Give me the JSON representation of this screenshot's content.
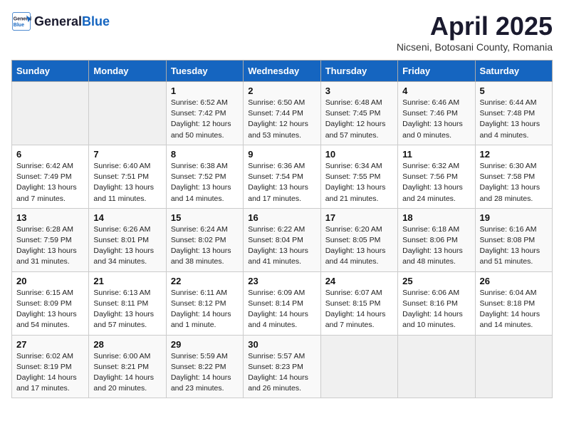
{
  "logo": {
    "general": "General",
    "blue": "Blue"
  },
  "title": "April 2025",
  "subtitle": "Nicseni, Botosani County, Romania",
  "days_of_week": [
    "Sunday",
    "Monday",
    "Tuesday",
    "Wednesday",
    "Thursday",
    "Friday",
    "Saturday"
  ],
  "weeks": [
    [
      {
        "day": "",
        "info": ""
      },
      {
        "day": "",
        "info": ""
      },
      {
        "day": "1",
        "info": "Sunrise: 6:52 AM\nSunset: 7:42 PM\nDaylight: 12 hours and 50 minutes."
      },
      {
        "day": "2",
        "info": "Sunrise: 6:50 AM\nSunset: 7:44 PM\nDaylight: 12 hours and 53 minutes."
      },
      {
        "day": "3",
        "info": "Sunrise: 6:48 AM\nSunset: 7:45 PM\nDaylight: 12 hours and 57 minutes."
      },
      {
        "day": "4",
        "info": "Sunrise: 6:46 AM\nSunset: 7:46 PM\nDaylight: 13 hours and 0 minutes."
      },
      {
        "day": "5",
        "info": "Sunrise: 6:44 AM\nSunset: 7:48 PM\nDaylight: 13 hours and 4 minutes."
      }
    ],
    [
      {
        "day": "6",
        "info": "Sunrise: 6:42 AM\nSunset: 7:49 PM\nDaylight: 13 hours and 7 minutes."
      },
      {
        "day": "7",
        "info": "Sunrise: 6:40 AM\nSunset: 7:51 PM\nDaylight: 13 hours and 11 minutes."
      },
      {
        "day": "8",
        "info": "Sunrise: 6:38 AM\nSunset: 7:52 PM\nDaylight: 13 hours and 14 minutes."
      },
      {
        "day": "9",
        "info": "Sunrise: 6:36 AM\nSunset: 7:54 PM\nDaylight: 13 hours and 17 minutes."
      },
      {
        "day": "10",
        "info": "Sunrise: 6:34 AM\nSunset: 7:55 PM\nDaylight: 13 hours and 21 minutes."
      },
      {
        "day": "11",
        "info": "Sunrise: 6:32 AM\nSunset: 7:56 PM\nDaylight: 13 hours and 24 minutes."
      },
      {
        "day": "12",
        "info": "Sunrise: 6:30 AM\nSunset: 7:58 PM\nDaylight: 13 hours and 28 minutes."
      }
    ],
    [
      {
        "day": "13",
        "info": "Sunrise: 6:28 AM\nSunset: 7:59 PM\nDaylight: 13 hours and 31 minutes."
      },
      {
        "day": "14",
        "info": "Sunrise: 6:26 AM\nSunset: 8:01 PM\nDaylight: 13 hours and 34 minutes."
      },
      {
        "day": "15",
        "info": "Sunrise: 6:24 AM\nSunset: 8:02 PM\nDaylight: 13 hours and 38 minutes."
      },
      {
        "day": "16",
        "info": "Sunrise: 6:22 AM\nSunset: 8:04 PM\nDaylight: 13 hours and 41 minutes."
      },
      {
        "day": "17",
        "info": "Sunrise: 6:20 AM\nSunset: 8:05 PM\nDaylight: 13 hours and 44 minutes."
      },
      {
        "day": "18",
        "info": "Sunrise: 6:18 AM\nSunset: 8:06 PM\nDaylight: 13 hours and 48 minutes."
      },
      {
        "day": "19",
        "info": "Sunrise: 6:16 AM\nSunset: 8:08 PM\nDaylight: 13 hours and 51 minutes."
      }
    ],
    [
      {
        "day": "20",
        "info": "Sunrise: 6:15 AM\nSunset: 8:09 PM\nDaylight: 13 hours and 54 minutes."
      },
      {
        "day": "21",
        "info": "Sunrise: 6:13 AM\nSunset: 8:11 PM\nDaylight: 13 hours and 57 minutes."
      },
      {
        "day": "22",
        "info": "Sunrise: 6:11 AM\nSunset: 8:12 PM\nDaylight: 14 hours and 1 minute."
      },
      {
        "day": "23",
        "info": "Sunrise: 6:09 AM\nSunset: 8:14 PM\nDaylight: 14 hours and 4 minutes."
      },
      {
        "day": "24",
        "info": "Sunrise: 6:07 AM\nSunset: 8:15 PM\nDaylight: 14 hours and 7 minutes."
      },
      {
        "day": "25",
        "info": "Sunrise: 6:06 AM\nSunset: 8:16 PM\nDaylight: 14 hours and 10 minutes."
      },
      {
        "day": "26",
        "info": "Sunrise: 6:04 AM\nSunset: 8:18 PM\nDaylight: 14 hours and 14 minutes."
      }
    ],
    [
      {
        "day": "27",
        "info": "Sunrise: 6:02 AM\nSunset: 8:19 PM\nDaylight: 14 hours and 17 minutes."
      },
      {
        "day": "28",
        "info": "Sunrise: 6:00 AM\nSunset: 8:21 PM\nDaylight: 14 hours and 20 minutes."
      },
      {
        "day": "29",
        "info": "Sunrise: 5:59 AM\nSunset: 8:22 PM\nDaylight: 14 hours and 23 minutes."
      },
      {
        "day": "30",
        "info": "Sunrise: 5:57 AM\nSunset: 8:23 PM\nDaylight: 14 hours and 26 minutes."
      },
      {
        "day": "",
        "info": ""
      },
      {
        "day": "",
        "info": ""
      },
      {
        "day": "",
        "info": ""
      }
    ]
  ]
}
